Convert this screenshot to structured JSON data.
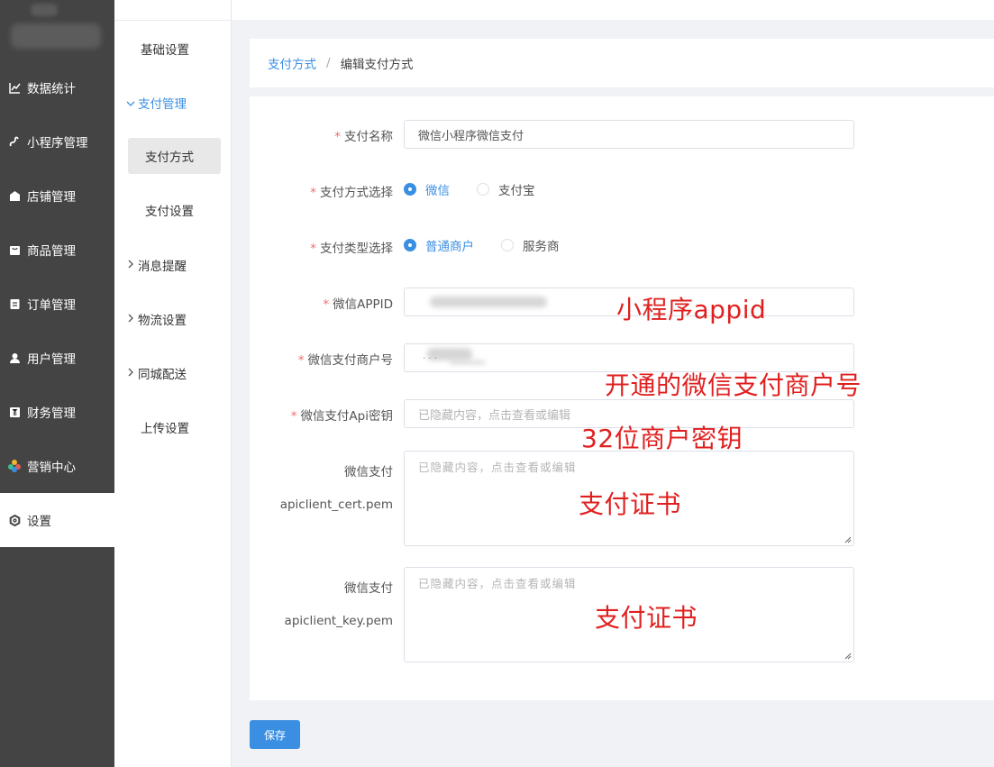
{
  "sidebar": {
    "items": [
      {
        "label": "数据统计",
        "icon": "chart-line-icon"
      },
      {
        "label": "小程序管理",
        "icon": "mini-program-icon"
      },
      {
        "label": "店铺管理",
        "icon": "shop-icon"
      },
      {
        "label": "商品管理",
        "icon": "goods-icon"
      },
      {
        "label": "订单管理",
        "icon": "order-icon"
      },
      {
        "label": "用户管理",
        "icon": "user-icon"
      },
      {
        "label": "财务管理",
        "icon": "finance-icon"
      },
      {
        "label": "营销中心",
        "icon": "marketing-icon"
      },
      {
        "label": "设置",
        "icon": "gear-icon",
        "active": true
      }
    ]
  },
  "submenu": {
    "basic": "基础设置",
    "payment_mgmt": "支付管理",
    "pay_method": "支付方式",
    "pay_settings": "支付设置",
    "notify": "消息提醒",
    "logistics": "物流设置",
    "city_delivery": "同城配送",
    "upload": "上传设置"
  },
  "breadcrumb": {
    "parent": "支付方式",
    "separator": "/",
    "current": "编辑支付方式"
  },
  "form": {
    "pay_name": {
      "label": "支付名称",
      "value": "微信小程序微信支付"
    },
    "pay_method": {
      "label": "支付方式选择",
      "options": [
        "微信",
        "支付宝"
      ],
      "selected": "微信"
    },
    "pay_type": {
      "label": "支付类型选择",
      "options": [
        "普通商户",
        "服务商"
      ],
      "selected": "普通商户"
    },
    "appid": {
      "label": "微信APPID"
    },
    "mch_id": {
      "label": "微信支付商户号",
      "value": ". . ."
    },
    "api_key": {
      "label": "微信支付Api密钥",
      "placeholder": "已隐藏内容，点击查看或编辑"
    },
    "cert": {
      "label_line1": "微信支付",
      "label_line2": "apiclient_cert.pem",
      "placeholder": "已隐藏内容，点击查看或编辑"
    },
    "key": {
      "label_line1": "微信支付",
      "label_line2": "apiclient_key.pem",
      "placeholder": "已隐藏内容，点击查看或编辑"
    }
  },
  "annotations": {
    "appid_note": "小程序appid",
    "mch_note": "开通的微信支付商户号",
    "key_note": "32位商户密钥",
    "cert_note": "支付证书",
    "keyfile_note": "支付证书"
  },
  "actions": {
    "save": "保存"
  },
  "colors": {
    "primary": "#3b8fe3",
    "required": "#f56c6c",
    "annotation": "#e02020",
    "sidebar_bg": "#444444"
  }
}
